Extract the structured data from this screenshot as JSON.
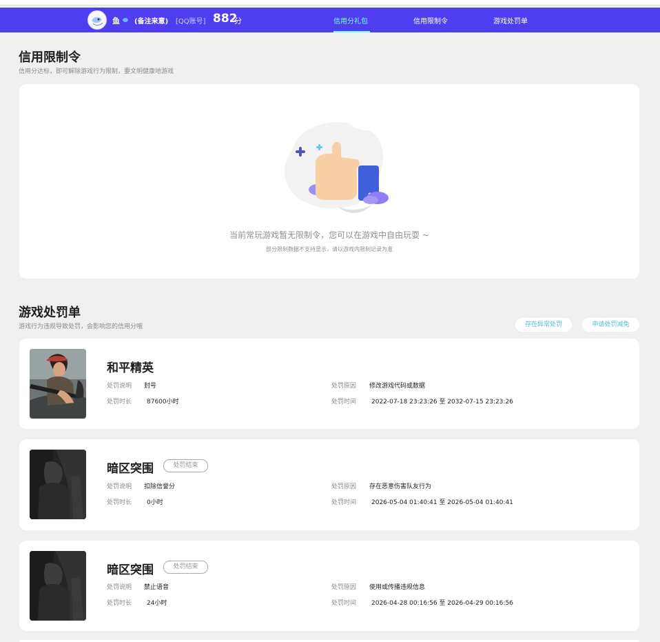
{
  "header": {
    "user_name": "鱼",
    "user_note": "(备注来意)",
    "qq_label": "[QQ账号]",
    "score": "882",
    "score_unit": "分",
    "nav": [
      {
        "label": "信用分礼包",
        "active": true
      },
      {
        "label": "信用限制令",
        "active": false
      },
      {
        "label": "游戏处罚单",
        "active": false
      }
    ]
  },
  "restriction": {
    "title": "信用限制令",
    "subtitle": "信用分达标，即可解除游戏行为限制，要文明健康地游戏",
    "empty_text": "当前常玩游戏暂无限制令，您可以在游戏中自由玩耍 ~",
    "empty_note": "部分限制数据不支持显示，请以游戏内限制记录为准"
  },
  "penalty": {
    "title": "游戏处罚单",
    "subtitle": "游戏行为违规导致处罚，会影响您的信用分哦",
    "buttons": [
      "存在异常处罚",
      "申请处罚减免"
    ],
    "labels": {
      "desc": "处罚说明",
      "duration": "处罚时长",
      "reason": "处罚原因",
      "time": "处罚时间"
    },
    "items": [
      {
        "game": "和平精英",
        "status": "",
        "desc": "封号",
        "duration": "87600小时",
        "reason": "修改游戏代码或数据",
        "time": "2022-07-18 23:23:26 至 2032-07-15 23:23:26"
      },
      {
        "game": "暗区突围",
        "status": "处罚结束",
        "desc": "扣除信誉分",
        "duration": "0小时",
        "reason": "存在恶意伤害队友行为",
        "time": "2026-05-04 01:40:41 至 2026-05-04 01:40:41"
      },
      {
        "game": "暗区突围",
        "status": "处罚结束",
        "desc": "禁止语音",
        "duration": "24小时",
        "reason": "使用或传播违规信息",
        "time": "2026-04-28 00:16:56 至 2026-04-29 00:16:56"
      }
    ]
  }
}
